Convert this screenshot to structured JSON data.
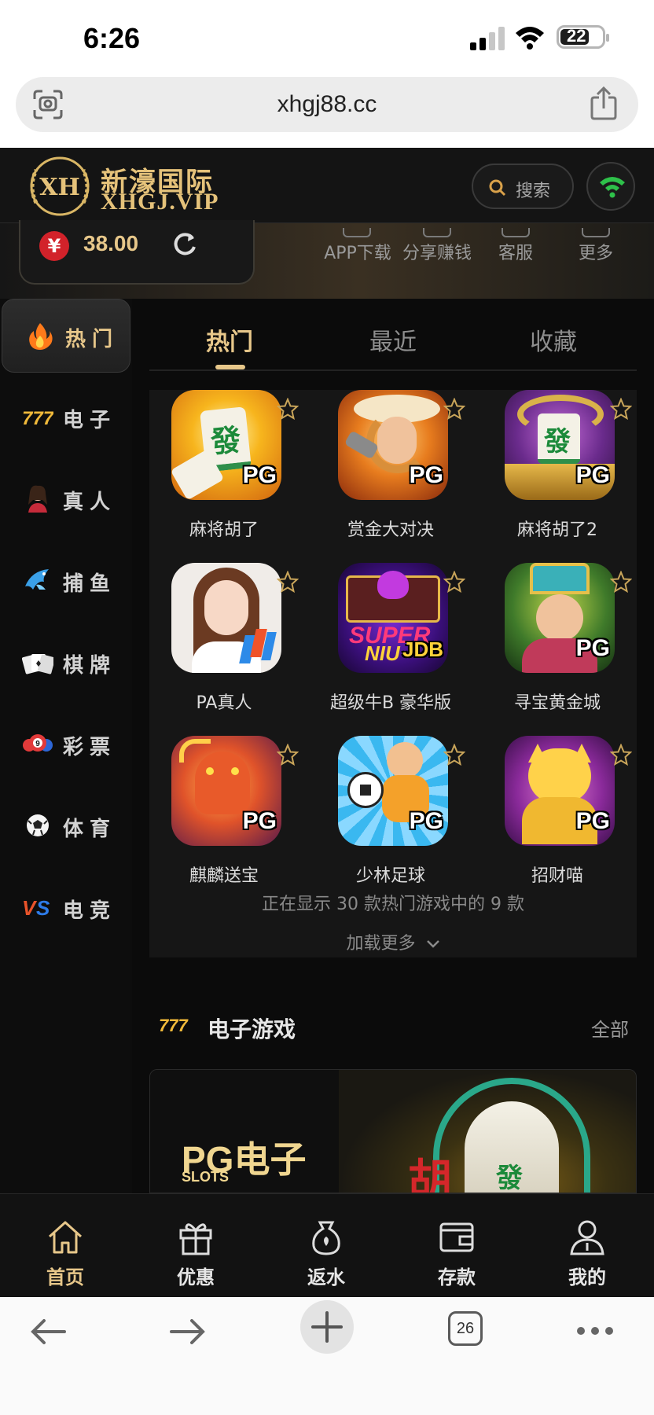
{
  "status_bar": {
    "time": "6:26",
    "battery": "22"
  },
  "browser": {
    "url": "xhgj88.cc",
    "tab_count": "26"
  },
  "header": {
    "logo_badge": "XH",
    "logo_cn": "新濠国际",
    "logo_en": "XHGJ.VIP",
    "search_label": "搜索"
  },
  "account": {
    "currency_symbol": "¥",
    "balance": "38.00"
  },
  "quick_links": [
    "APP下载",
    "分享赚钱",
    "客服",
    "更多"
  ],
  "sidebar": {
    "items": [
      {
        "label": "热门",
        "icon": "flame-icon"
      },
      {
        "label": "电子",
        "icon": "777-icon"
      },
      {
        "label": "真人",
        "icon": "dealer-icon"
      },
      {
        "label": "捕鱼",
        "icon": "fish-icon"
      },
      {
        "label": "棋牌",
        "icon": "cards-icon"
      },
      {
        "label": "彩票",
        "icon": "lottery-ball-icon"
      },
      {
        "label": "体育",
        "icon": "soccer-ball-icon"
      },
      {
        "label": "电竞",
        "icon": "vs-icon"
      }
    ]
  },
  "tabs": [
    "热门",
    "最近",
    "收藏"
  ],
  "games": [
    {
      "name": "麻将胡了",
      "badge": "PG"
    },
    {
      "name": "赏金大对决",
      "badge": "PG"
    },
    {
      "name": "麻将胡了2",
      "badge": "PG"
    },
    {
      "name": "PA真人",
      "badge": ""
    },
    {
      "name": "超级牛B 豪华版",
      "badge": "JDB"
    },
    {
      "name": "寻宝黄金城",
      "badge": "PG"
    },
    {
      "name": "麒麟送宝",
      "badge": "PG"
    },
    {
      "name": "少林足球",
      "badge": "PG"
    },
    {
      "name": "招财喵",
      "badge": "PG"
    }
  ],
  "games_status": "正在显示 30 款热门游戏中的 9 款",
  "load_more": "加载更多",
  "section": {
    "title": "电子游戏",
    "all": "全部"
  },
  "banner": {
    "brand": "PG电子",
    "sub": "SLOTS"
  },
  "bottom_nav": [
    "首页",
    "优惠",
    "返水",
    "存款",
    "我的"
  ],
  "colors": {
    "accent_gold": "#e7c78a",
    "background": "#0b0b0b",
    "panel": "#161616"
  }
}
